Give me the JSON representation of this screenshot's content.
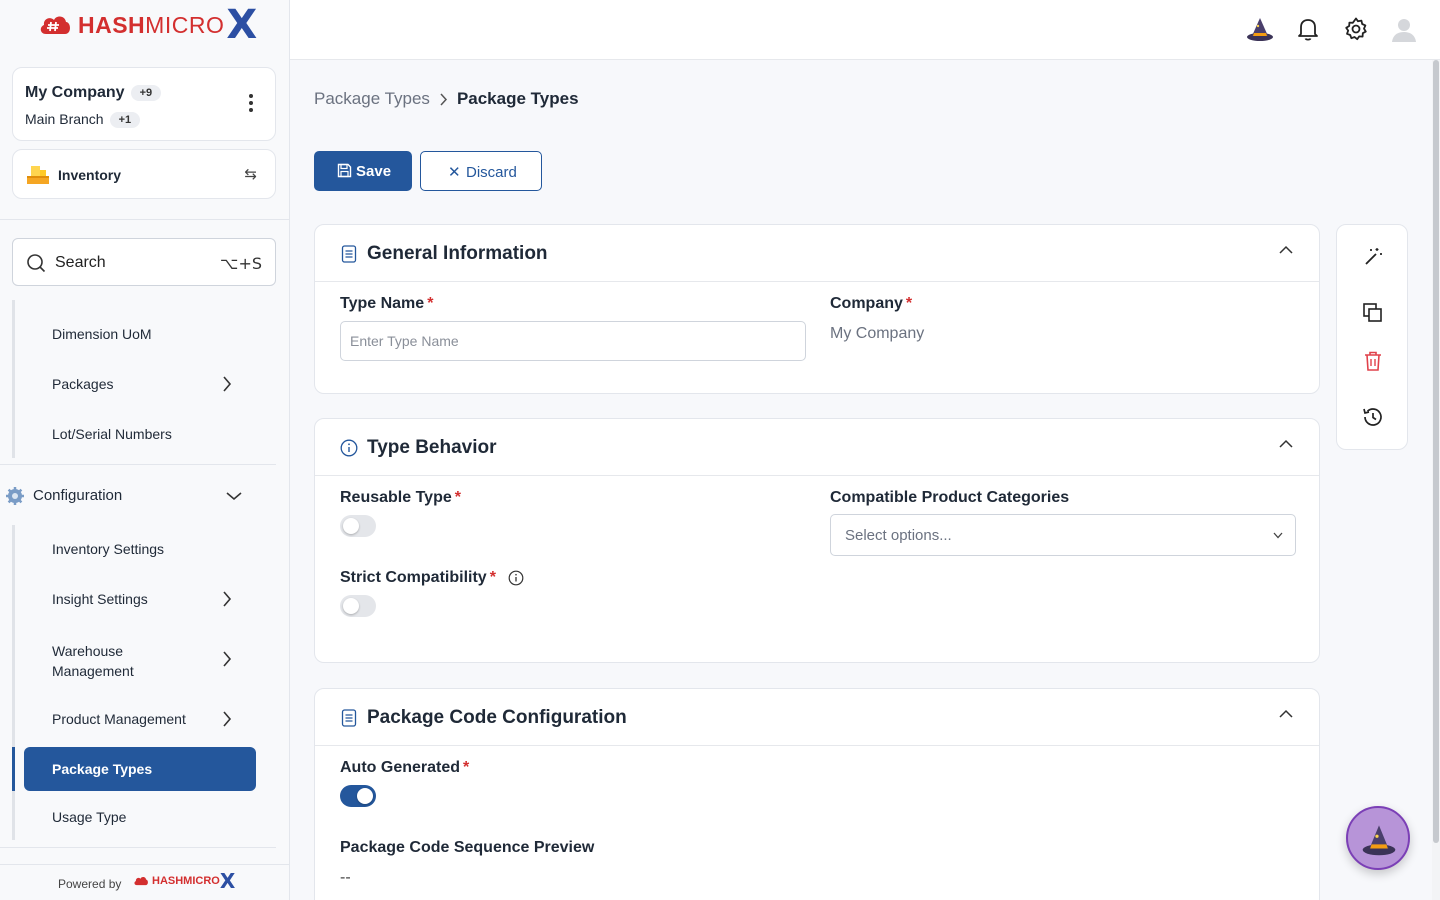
{
  "brand": {
    "name_bold": "HASH",
    "name_rest": "MICRO",
    "x": "X"
  },
  "company": {
    "name": "My Company",
    "name_badge": "+9",
    "branch": "Main Branch",
    "branch_badge": "+1"
  },
  "module": {
    "label": "Inventory"
  },
  "search": {
    "label": "Search",
    "shortcut": "⌥+S"
  },
  "nav": {
    "inventory_items": [
      {
        "label": "Dimension UoM"
      },
      {
        "label": "Packages"
      },
      {
        "label": "Lot/Serial Numbers"
      }
    ],
    "configuration": {
      "label": "Configuration",
      "items": [
        {
          "label": "Inventory Settings"
        },
        {
          "label": "Insight Settings"
        },
        {
          "label": "Warehouse Management"
        },
        {
          "label": "Product Management"
        },
        {
          "label": "Package Types"
        },
        {
          "label": "Usage Type"
        }
      ]
    }
  },
  "powered": {
    "label": "Powered by",
    "logo_text": "HASHMICRO",
    "logo_x": "X"
  },
  "breadcrumb": {
    "parent": "Package Types",
    "current": "Package Types"
  },
  "toolbar": {
    "save_label": "Save",
    "discard_label": "Discard"
  },
  "general": {
    "title": "General Information",
    "type_name_label": "Type Name",
    "type_name_placeholder": "Enter Type Name",
    "company_label": "Company",
    "company_value": "My Company"
  },
  "behavior": {
    "title": "Type Behavior",
    "reusable_label": "Reusable Type",
    "reusable_on": false,
    "categories_label": "Compatible Product Categories",
    "categories_placeholder": "Select options...",
    "strict_label": "Strict Compatibility",
    "strict_on": false
  },
  "code": {
    "title": "Package Code Configuration",
    "auto_label": "Auto Generated",
    "auto_on": true,
    "preview_label": "Package Code Sequence Preview",
    "preview_value": "--"
  },
  "required_mark": "*",
  "colors": {
    "primary": "#24579c",
    "brand_red": "#d32f2f",
    "danger": "#e0424b"
  }
}
